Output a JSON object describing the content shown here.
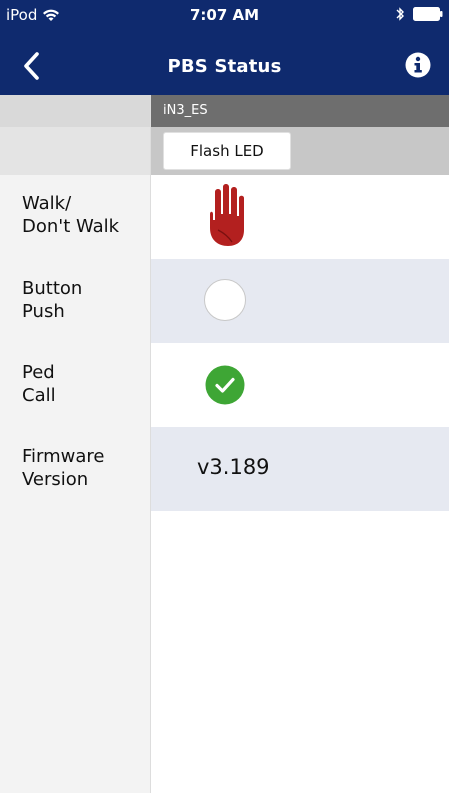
{
  "status_bar": {
    "carrier": "iPod",
    "time": "7:07 AM",
    "icons": [
      "wifi-icon",
      "bluetooth-icon",
      "battery-icon"
    ]
  },
  "nav": {
    "title": "PBS Status",
    "back_icon": "chevron-left-icon",
    "info_icon": "info-icon"
  },
  "device": {
    "name": "iN3_ES",
    "flash_button_label": "Flash LED"
  },
  "rows": [
    {
      "label": "Walk/\nDon't Walk",
      "indicator": "hand-stop-icon"
    },
    {
      "label": "Button\nPush",
      "indicator": "empty-circle"
    },
    {
      "label": "Ped\nCall",
      "indicator": "check-circle-icon"
    },
    {
      "label": "Firmware\nVersion",
      "value": "v3.189"
    }
  ],
  "colors": {
    "nav_background": "#0f2a6e",
    "device_header": "#6e6e6e",
    "alt_row": "#e6e9f1",
    "hand_red": "#b3201f",
    "check_green": "#3ea635"
  }
}
